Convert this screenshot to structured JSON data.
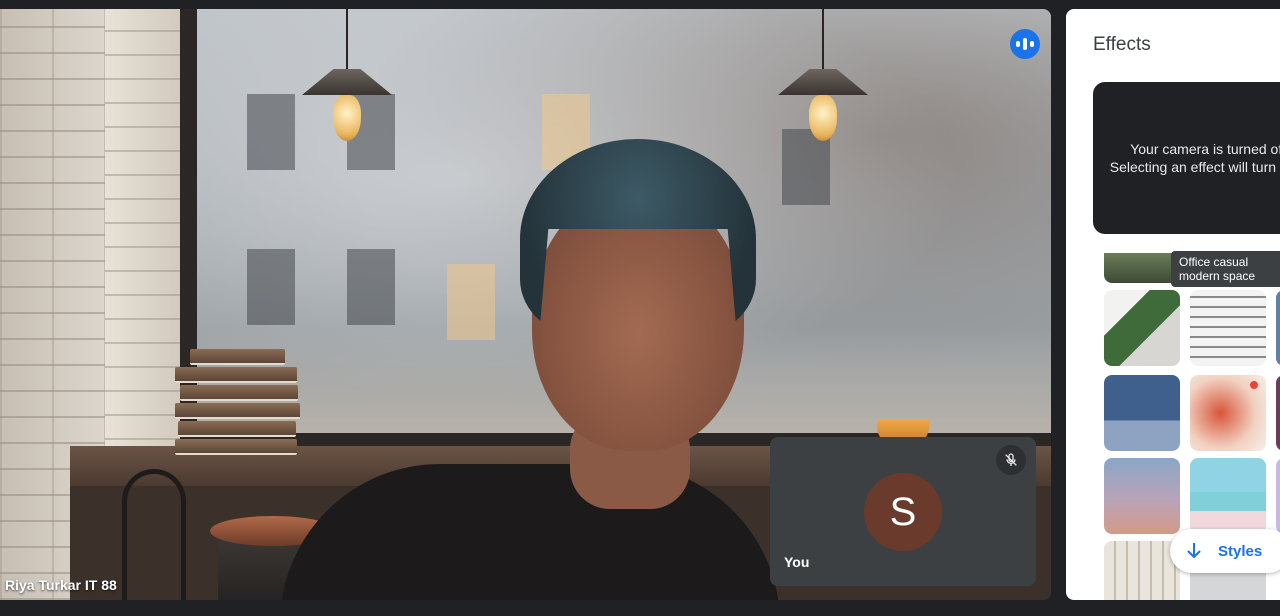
{
  "main_video": {
    "participant_name": "Riya Turkar IT 88"
  },
  "self_view": {
    "avatar_letter": "S",
    "name": "You"
  },
  "effects_panel": {
    "title": "Effects",
    "camera_off_message": "Your camera is turned off. Selecting an effect will turn it on.",
    "tooltip": "Office casual modern space",
    "styles_label": "Styles",
    "thumbnails": [
      {
        "name": "office-casual-modern-space",
        "icon": "landscape-thumb"
      },
      {
        "name": "indoor-garden",
        "icon": "garden-thumb"
      },
      {
        "name": "library-room",
        "icon": "library-thumb"
      },
      {
        "name": "blue-living-room",
        "icon": "living-room-thumb"
      },
      {
        "name": "koi-fish-art",
        "icon": "koi-thumb"
      },
      {
        "name": "purple-gradient",
        "icon": "gradient-thumb"
      },
      {
        "name": "tropical-beach",
        "icon": "beach-thumb"
      },
      {
        "name": "gallery-wall",
        "icon": "gallery-thumb"
      },
      {
        "name": "partial-thumbnail",
        "icon": "thumb"
      }
    ]
  },
  "colors": {
    "background": "#202124",
    "accent": "#1a73e8",
    "tile": "#3c4043",
    "avatar": "#6a3b2d"
  }
}
